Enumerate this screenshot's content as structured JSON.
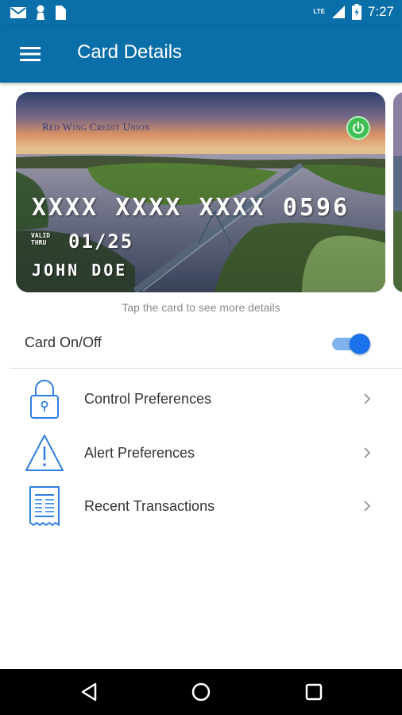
{
  "status_bar": {
    "network_label": "LTE",
    "time": "7:27"
  },
  "app_bar": {
    "title": "Card Details"
  },
  "card": {
    "bank_name": "Red Wing Credit Union",
    "number": "XXXX XXXX XXXX 0596",
    "valid_label": "VALID THRU",
    "expiry": "01/25",
    "holder": "JOHN DOE",
    "power_state": "on"
  },
  "hint": "Tap the card to see more details",
  "card_toggle": {
    "label": "Card On/Off",
    "checked": true
  },
  "menu": [
    {
      "label": "Control Preferences",
      "icon": "lock-icon"
    },
    {
      "label": "Alert Preferences",
      "icon": "warning-icon"
    },
    {
      "label": "Recent Transactions",
      "icon": "receipt-icon"
    }
  ],
  "colors": {
    "primary": "#0a6ea8",
    "accent": "#1a73e8",
    "icon_blue": "#2f7fe0",
    "power_green": "#3fbf55"
  },
  "nav": {
    "buttons": [
      "back-icon",
      "home-icon",
      "recents-icon"
    ]
  }
}
